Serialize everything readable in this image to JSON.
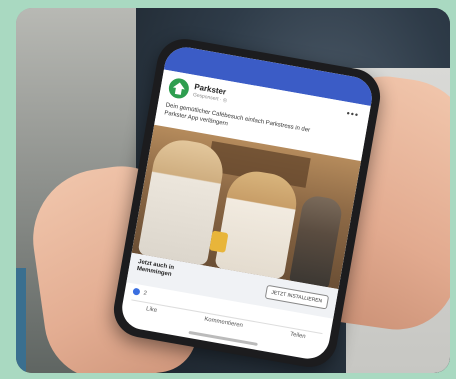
{
  "ad": {
    "page_name": "Parkster",
    "sponsored": "Gesponsert · ◎",
    "more": "•••",
    "text": "Dein gemütlicher Cafébesuch einfach Parkstress in der Parkster App verlängern",
    "cta_text": "Jetzt auch in Memmingen",
    "cta_button": "JETZT INSTALLIEREN",
    "reaction_count": "2",
    "actions": [
      "Like",
      "Kommentieren",
      "Teilen"
    ]
  },
  "colors": {
    "background": "#a9d9c1",
    "topbar": "#3b5cc6",
    "brand": "#2e9e4f"
  }
}
